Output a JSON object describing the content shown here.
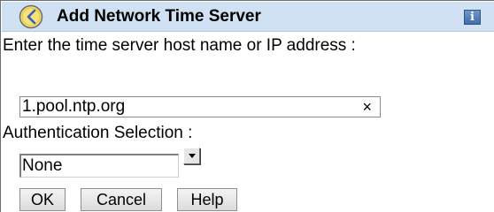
{
  "dialog": {
    "title": "Add Network Time Server",
    "title_icon": "clock-icon",
    "info_icon_label": "i",
    "host_label": "Enter the time server host name or IP address :",
    "host_value": "1.pool.ntp.org",
    "clear_icon": "×",
    "auth_label": "Authentication Selection :",
    "auth_selected": "None"
  },
  "buttons": {
    "ok": "OK",
    "cancel": "Cancel",
    "help": "Help"
  },
  "colors": {
    "titlebar_bg": "#cfe1f2",
    "clock_face": "#f5e27a",
    "clock_hands": "#3a5fb0"
  }
}
